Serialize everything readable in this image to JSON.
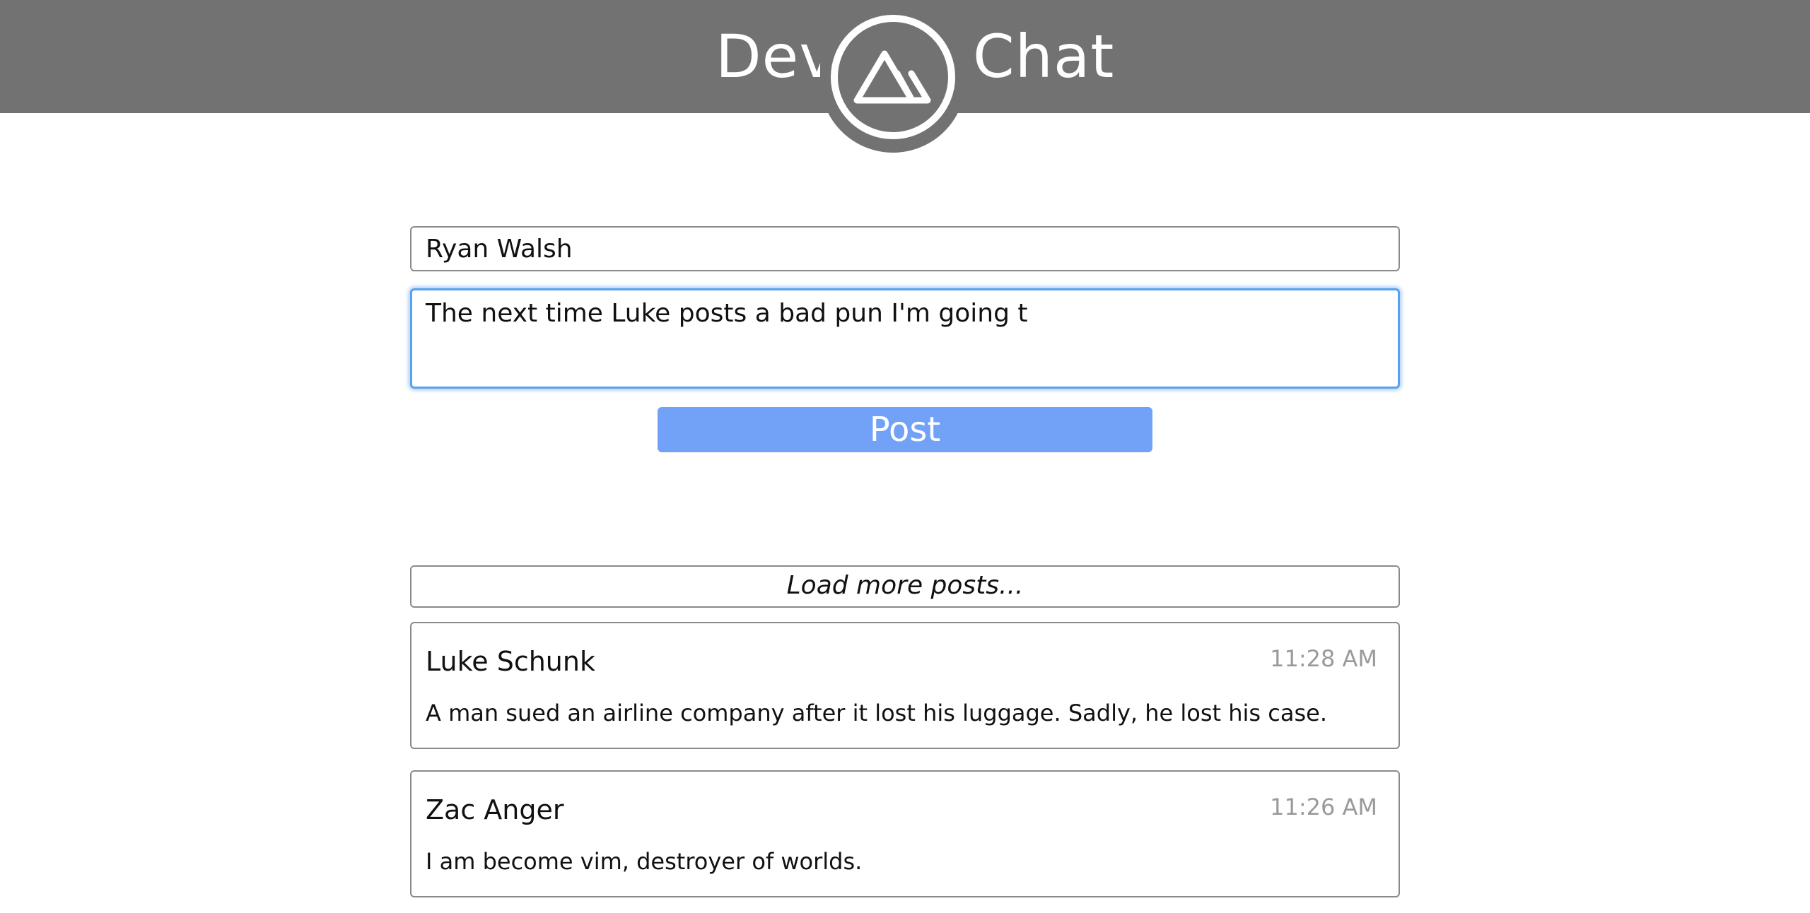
{
  "header": {
    "brand_left": "Dev",
    "brand_right": "Chat",
    "logo_icon": "mountain-icon",
    "background_color": "#727272"
  },
  "composer": {
    "name_value": "Ryan Walsh",
    "message_value": "The next time Luke posts a bad pun I'm going t",
    "post_label": "Post",
    "post_button_color": "#72a2f8",
    "focus_color": "#5aa0f0"
  },
  "feed": {
    "load_more_label": "Load more posts...",
    "posts": [
      {
        "author": "Luke Schunk",
        "time": "11:28 AM",
        "text": "A man sued an airline company after it lost his luggage. Sadly, he lost his case."
      },
      {
        "author": "Zac Anger",
        "time": "11:26 AM",
        "text": "I am become vim, destroyer of worlds."
      }
    ]
  }
}
